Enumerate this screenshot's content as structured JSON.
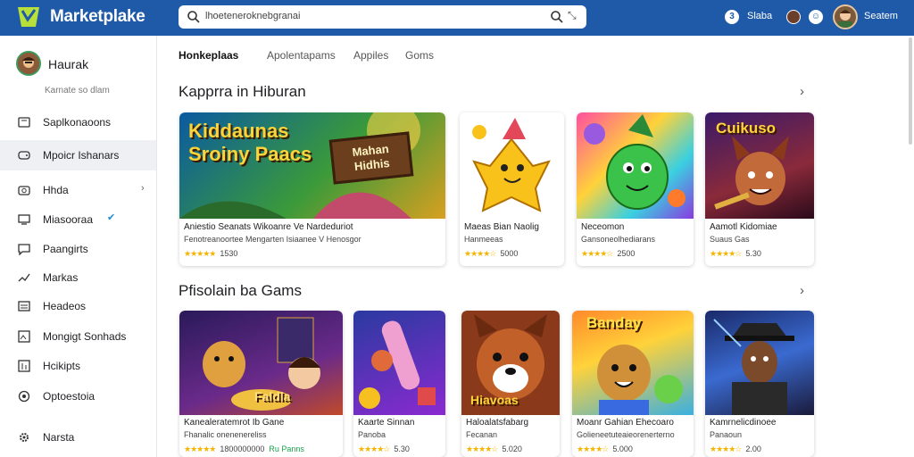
{
  "app": {
    "brand": "Marketplake",
    "colors": {
      "topbar": "#1e5aa8",
      "accent": "#1a8ccf",
      "star": "#f5b400"
    }
  },
  "search": {
    "value": "lhoeteneroknebgranai"
  },
  "topbar": {
    "badge": "3",
    "label1": "Slaba",
    "user_name": "Seatem"
  },
  "sidebar": {
    "profile": {
      "name": "Haurak",
      "subtitle": "Karnate so dlam"
    },
    "items": [
      {
        "label": "Saplkonaoons",
        "icon": "book-icon"
      },
      {
        "label": "Mpoicr Ishanars",
        "icon": "gamepad-icon",
        "active": true
      },
      {
        "label": "Hhda",
        "icon": "camera-icon",
        "right": "›"
      },
      {
        "label": "Miasooraa",
        "icon": "monitor-icon",
        "right": "✔"
      },
      {
        "label": "Paangirts",
        "icon": "chat-icon"
      },
      {
        "label": "Markas",
        "icon": "pen-icon"
      },
      {
        "label": "Headeos",
        "icon": "list-icon"
      },
      {
        "label": "Mongigt Sonhads",
        "icon": "image-icon"
      },
      {
        "label": "Hcikipts",
        "icon": "chart-icon"
      },
      {
        "label": "Optoestoia",
        "icon": "settings-icon"
      },
      {
        "label": "Narsta",
        "icon": "gear-icon"
      }
    ]
  },
  "tabs": [
    "Honkeplaas",
    "Apolentapams",
    "Appiles",
    "Goms"
  ],
  "sections": [
    {
      "title": "Kapprra in Hiburan",
      "cards": [
        {
          "art": "Kiddaunas Sroiny Paacs",
          "art2": "Mahan Hidhis",
          "line1": "Aniestio Seanats Wikoanre Ve Nardeduriot",
          "line2": "Fenotreanoortee Mengarten  Isiaanee V Henosgor",
          "stars": "★★★★★",
          "rating": "1530"
        },
        {
          "line1": "Maeas Bian Naolig",
          "line2": "Hanmeeas",
          "stars": "★★★★☆",
          "rating": "5000"
        },
        {
          "line1": "Neceomon",
          "line2": "Gansoneolhediarans",
          "stars": "★★★★☆",
          "rating": "2500"
        },
        {
          "art": "Cuikuso",
          "line1": "Aamotl Kidomiae",
          "line2": "Suaus Gas",
          "stars": "★★★★☆",
          "rating": "5.30"
        }
      ]
    },
    {
      "title": "Pfisolain ba Gams",
      "cards": [
        {
          "art": "Faldla",
          "line1": "Kanealeratemrot Ib Gane",
          "line2": "Fhanalic onenenereliss",
          "stars": "★★★★★",
          "rating": "1800000000",
          "tag": "Ru Panns"
        },
        {
          "line1": "Kaarte Sinnan",
          "line2": "Panoba",
          "stars": "★★★★☆",
          "rating": "5.30"
        },
        {
          "art": "Hiavoas",
          "line1": "Haloalatsfabarg",
          "line2": "Fecanan",
          "stars": "★★★★☆",
          "rating": "5.020"
        },
        {
          "art": "Banday",
          "line1": "Moanr Gahian Ehecoaro",
          "line2": "Golieneetuteaieorenerterno",
          "stars": "★★★★☆",
          "rating": "5.000"
        },
        {
          "line1": "Kamrnelicdinoee",
          "line2": "Panaoun",
          "stars": "★★★★☆",
          "rating": "2.00"
        }
      ]
    }
  ]
}
